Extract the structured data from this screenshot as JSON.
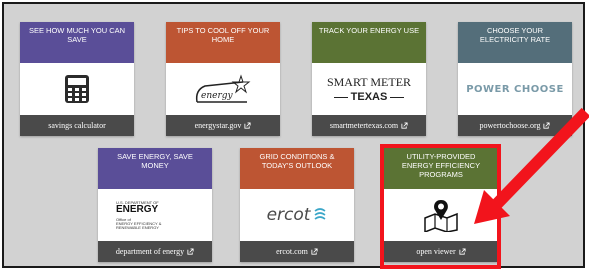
{
  "colors": {
    "purple": "#5a4e98",
    "orange": "#bd5533",
    "green": "#5b7334",
    "slate": "#546e7a",
    "footer": "#4a4a4a",
    "highlight": "#f2141c"
  },
  "cards": [
    {
      "title": "SEE HOW MUCH YOU CAN SAVE",
      "link": "savings calculator",
      "icon": "calculator-icon"
    },
    {
      "title": "TIPS TO COOL OFF YOUR HOME",
      "link": "energystar.gov",
      "icon": "energy-star-logo"
    },
    {
      "title": "TRACK YOUR ENERGY USE",
      "link": "smartmetertexas.com",
      "icon": "smart-meter-texas-logo",
      "logo_line1": "SMART METER",
      "logo_line2": "TEXAS"
    },
    {
      "title": "CHOOSE YOUR ELECTRICITY RATE",
      "link": "powertochoose.org",
      "icon": "power-to-choose-logo",
      "logo": "POWER CHOOSE"
    },
    {
      "title": "SAVE ENERGY, SAVE MONEY",
      "link": "department of energy",
      "icon": "doe-logo",
      "logo_small": "U.S. DEPARTMENT OF",
      "logo_big": "ENERGY",
      "logo_sub1": "Office of",
      "logo_sub2": "ENERGY EFFICIENCY &",
      "logo_sub3": "RENEWABLE ENERGY"
    },
    {
      "title": "GRID CONDITIONS & TODAY'S OUTLOOK",
      "link": "ercot.com",
      "icon": "ercot-logo",
      "logo": "ercot"
    },
    {
      "title": "UTILITY-PROVIDED ENERGY EFFICIENCY PROGRAMS",
      "link": "open viewer",
      "icon": "map-pin-icon"
    }
  ]
}
